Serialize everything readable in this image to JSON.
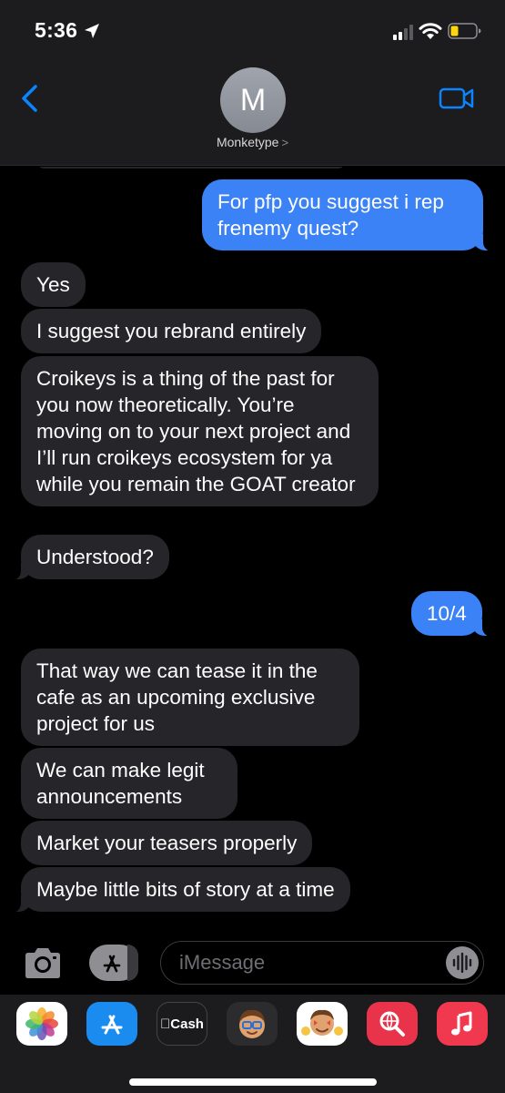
{
  "status_bar": {
    "time": "5:36"
  },
  "header": {
    "avatar_initial": "M",
    "contact_name": "Monketype",
    "chevron": ">"
  },
  "messages": [
    {
      "side": "out",
      "text": "For pfp you suggest i rep frenemy quest?"
    },
    {
      "side": "in",
      "text": "Yes"
    },
    {
      "side": "in",
      "text": "I suggest you rebrand entirely"
    },
    {
      "side": "in",
      "text": "Croikeys is a thing of the past for you now theoretically. You’re moving on to your next project and I’ll run croikeys ecosystem for ya while you remain the GOAT creator"
    },
    {
      "side": "in",
      "text": "Understood?"
    },
    {
      "side": "out",
      "text": "10/4"
    },
    {
      "side": "in",
      "text": "That way we can tease it in the cafe as an upcoming exclusive project for us"
    },
    {
      "side": "in",
      "text": "We can make legit announcements"
    },
    {
      "side": "in",
      "text": "Market your teasers properly"
    },
    {
      "side": "in",
      "text": "Maybe little bits of story at a time"
    }
  ],
  "input": {
    "placeholder": "iMessage"
  },
  "app_drawer": {
    "apps": [
      {
        "icon": "photos-icon"
      },
      {
        "icon": "app-store-icon"
      },
      {
        "icon": "apple-cash-icon",
        "label": "Cash"
      },
      {
        "icon": "memoji-icon"
      },
      {
        "icon": "memoji-stickers-icon"
      },
      {
        "icon": "web-images-search-icon"
      },
      {
        "icon": "music-icon"
      }
    ]
  },
  "colors": {
    "outgoing_bubble": "#3b82f6",
    "incoming_bubble": "#26252a",
    "accent": "#0a84ff",
    "bar_background": "#1c1c1e"
  }
}
